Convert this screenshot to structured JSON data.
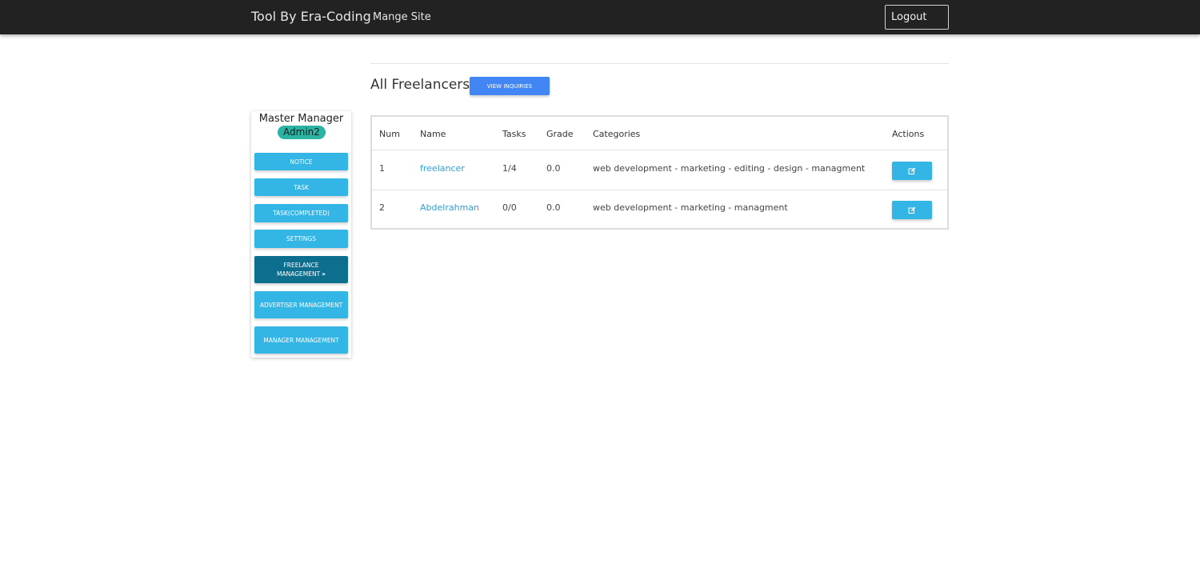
{
  "navbar": {
    "brand": "Tool By Era-Coding",
    "manage_link": "Mange Site",
    "logout_label": "Logout"
  },
  "sidebar": {
    "title": "Master Manager",
    "user_badge": "Admin2",
    "items": [
      {
        "label": "Notice"
      },
      {
        "label": "Task"
      },
      {
        "label": "Task(Completed)"
      },
      {
        "label": "Settings"
      },
      {
        "label": "Freelance Management",
        "active": true,
        "icon": "double-chevron-right-icon"
      },
      {
        "label": "Advertiser Management"
      },
      {
        "label": "Manager Management"
      }
    ]
  },
  "main": {
    "title": "All Freelancers",
    "view_inquiries_label": "View Inquiries",
    "table": {
      "headers": {
        "num": "Num",
        "name": "Name",
        "tasks": "Tasks",
        "grade": "Grade",
        "categories": "Categories",
        "actions": "Actions"
      },
      "rows": [
        {
          "num": "1",
          "name": "freelancer",
          "tasks": "1/4",
          "grade": "0.0",
          "categories": "web development - marketing - editing - design - managment",
          "action_icon": "edit-icon"
        },
        {
          "num": "2",
          "name": "Abdelrahman",
          "tasks": "0/0",
          "grade": "0.0",
          "categories": "web development - marketing - managment",
          "action_icon": "edit-icon"
        }
      ]
    }
  },
  "colors": {
    "navbar_bg": "#222222",
    "primary_button": "#33b5e5",
    "active_button": "#0d6e8e",
    "inquiries_button": "#4285f4",
    "badge": "#2bb3a3",
    "link": "#2f9fd8"
  }
}
